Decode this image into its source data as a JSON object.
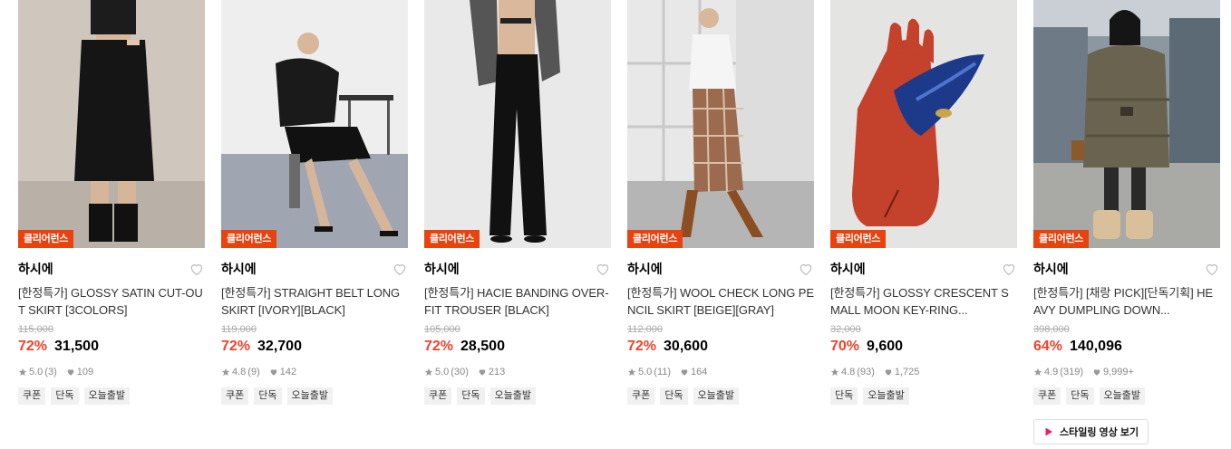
{
  "products": [
    {
      "badge": "클리어런스",
      "brand": "하시에",
      "title": "[한정특가] GLOSSY SATIN CUT-OUT SKIRT [3COLORS]",
      "original_price": "115,000",
      "discount": "72%",
      "price": "31,500",
      "rating": "5.0",
      "review_count": "(3)",
      "likes": "109",
      "tags": [
        "쿠폰",
        "단독",
        "오늘출발"
      ]
    },
    {
      "badge": "클리어런스",
      "brand": "하시에",
      "title": "[한정특가] STRAIGHT BELT LONG SKIRT [IVORY][BLACK]",
      "original_price": "119,000",
      "discount": "72%",
      "price": "32,700",
      "rating": "4.8",
      "review_count": "(9)",
      "likes": "142",
      "tags": [
        "쿠폰",
        "단독",
        "오늘출발"
      ]
    },
    {
      "badge": "클리어런스",
      "brand": "하시에",
      "title": "[한정특가] HACIE BANDING OVER-FIT TROUSER [BLACK]",
      "original_price": "105,000",
      "discount": "72%",
      "price": "28,500",
      "rating": "5.0",
      "review_count": "(30)",
      "likes": "213",
      "tags": [
        "쿠폰",
        "단독",
        "오늘출발"
      ]
    },
    {
      "badge": "클리어런스",
      "brand": "하시에",
      "title": "[한정특가] WOOL CHECK LONG PENCIL SKIRT [BEIGE][GRAY]",
      "original_price": "112,000",
      "discount": "72%",
      "price": "30,600",
      "rating": "5.0",
      "review_count": "(11)",
      "likes": "164",
      "tags": [
        "쿠폰",
        "단독",
        "오늘출발"
      ]
    },
    {
      "badge": "클리어런스",
      "brand": "하시에",
      "title": "[한정특가] GLOSSY CRESCENT SMALL MOON KEY-RING...",
      "original_price": "32,000",
      "discount": "70%",
      "price": "9,600",
      "rating": "4.8",
      "review_count": "(93)",
      "likes": "1,725",
      "tags": [
        "단독",
        "오늘출발"
      ]
    },
    {
      "badge": "클리어런스",
      "brand": "하시에",
      "title": "[한정특가] [채랑 PICK][단독기획] HEAVY DUMPLING DOWN...",
      "original_price": "398,000",
      "discount": "64%",
      "price": "140,096",
      "rating": "4.9",
      "review_count": "(319)",
      "likes": "9,999+",
      "tags": [
        "쿠폰",
        "단독",
        "오늘출발"
      ],
      "video_button": "스타일링 영상 보기"
    }
  ],
  "colors": {
    "badge": "#e8420f",
    "discount": "#f0412a",
    "tag_bg": "#f1f1f1"
  }
}
